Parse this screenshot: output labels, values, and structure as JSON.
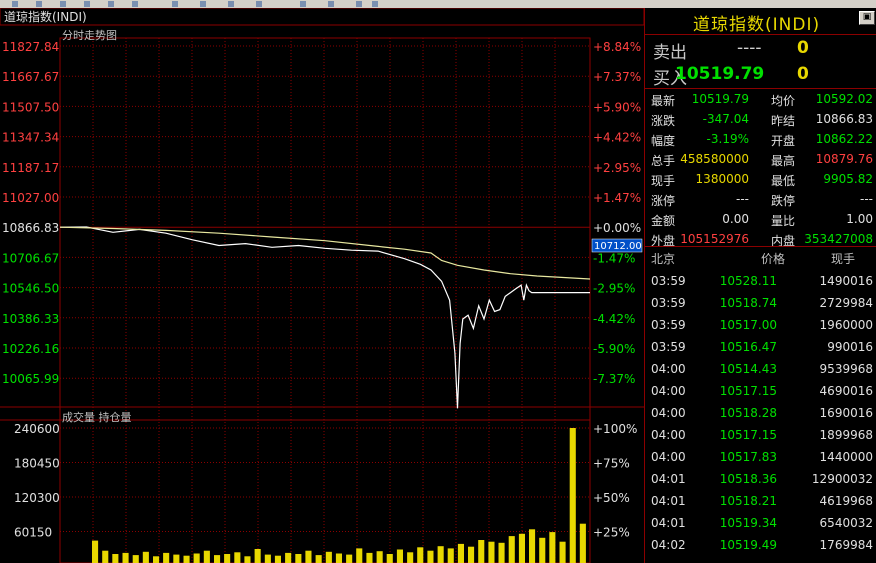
{
  "window": {
    "title": "道琼指数(INDI)"
  },
  "chart_panel": {
    "caption": "道琼指数(INDI)",
    "intraday_label": "分时走势图",
    "volume_label": "成交量 持仓量",
    "current_value_tag": "10712.00",
    "price_axis": [
      "11827.84",
      "11667.67",
      "11507.50",
      "11347.34",
      "11187.17",
      "11027.00",
      "10866.83",
      "10706.67",
      "10546.50",
      "10386.33",
      "10226.16",
      "10065.99"
    ],
    "pct_axis": [
      "+8.84%",
      "+7.37%",
      "+5.90%",
      "+4.42%",
      "+2.95%",
      "+1.47%",
      "+0.00%",
      "-1.47%",
      "-2.95%",
      "-4.42%",
      "-5.90%",
      "-7.37%"
    ],
    "volume_axis": [
      "240600",
      "180450",
      "120300",
      "60150"
    ],
    "volume_pct_axis": [
      "+100%",
      "+75%",
      "+50%",
      "+25%"
    ],
    "colors": {
      "grid": "#8b0000",
      "price_line": "#ffffff",
      "avg_line": "#e8e8a0",
      "volume": "#e8d800",
      "positive": "#ff4040",
      "negative": "#00e000"
    }
  },
  "side_panel": {
    "title": "道琼指数(INDI)",
    "sell": {
      "label": "卖出",
      "price": "----",
      "volume": "0"
    },
    "buy": {
      "label": "买入",
      "price": "10519.79",
      "volume": "0"
    },
    "quote": [
      {
        "l1": "最新",
        "v1": "10519.79",
        "c1": "g",
        "l2": "均价",
        "v2": "10592.02",
        "c2": "g"
      },
      {
        "l1": "涨跌",
        "v1": "-347.04",
        "c1": "g",
        "l2": "昨结",
        "v2": "10866.83",
        "c2": "w"
      },
      {
        "l1": "幅度",
        "v1": "-3.19%",
        "c1": "g",
        "l2": "开盘",
        "v2": "10862.22",
        "c2": "g"
      },
      {
        "l1": "总手",
        "v1": "458580000",
        "c1": "y",
        "l2": "最高",
        "v2": "10879.76",
        "c2": "r"
      },
      {
        "l1": "现手",
        "v1": "1380000",
        "c1": "y",
        "l2": "最低",
        "v2": "9905.82",
        "c2": "g"
      },
      {
        "l1": "涨停",
        "v1": "---",
        "c1": "w",
        "l2": "跌停",
        "v2": "---",
        "c2": "w"
      },
      {
        "l1": "金额",
        "v1": "0.00",
        "c1": "w",
        "l2": "量比",
        "v2": "1.00",
        "c2": "w"
      },
      {
        "l1": "外盘",
        "v1": "105152976",
        "c1": "r",
        "l2": "内盘",
        "v2": "353427008",
        "c2": "g"
      }
    ],
    "ticks_header": {
      "time": "北京",
      "price": "价格",
      "volume": "现手"
    },
    "ticks": [
      {
        "time": "03:59",
        "price": "10528.11",
        "volume": "1490016"
      },
      {
        "time": "03:59",
        "price": "10518.74",
        "volume": "2729984"
      },
      {
        "time": "03:59",
        "price": "10517.00",
        "volume": "1960000"
      },
      {
        "time": "03:59",
        "price": "10516.47",
        "volume": "990016"
      },
      {
        "time": "04:00",
        "price": "10514.43",
        "volume": "9539968"
      },
      {
        "time": "04:00",
        "price": "10517.15",
        "volume": "4690016"
      },
      {
        "time": "04:00",
        "price": "10518.28",
        "volume": "1690016"
      },
      {
        "time": "04:00",
        "price": "10517.15",
        "volume": "1899968"
      },
      {
        "time": "04:00",
        "price": "10517.83",
        "volume": "1440000"
      },
      {
        "time": "04:01",
        "price": "10518.36",
        "volume": "12900032"
      },
      {
        "time": "04:01",
        "price": "10518.21",
        "volume": "4619968"
      },
      {
        "time": "04:01",
        "price": "10519.34",
        "volume": "6540032"
      },
      {
        "time": "04:02",
        "price": "10519.49",
        "volume": "1769984"
      }
    ]
  },
  "chart_data": {
    "type": "line",
    "title": "分时走势图",
    "ylim": [
      9905.82,
      11827.84
    ],
    "reference_close": 10866.83,
    "series": [
      {
        "name": "price",
        "x": [
          0,
          0.05,
          0.1,
          0.15,
          0.2,
          0.25,
          0.3,
          0.35,
          0.4,
          0.45,
          0.5,
          0.55,
          0.6,
          0.65,
          0.68,
          0.7,
          0.72,
          0.735,
          0.745,
          0.75,
          0.755,
          0.76,
          0.77,
          0.78,
          0.79,
          0.8,
          0.81,
          0.82,
          0.83,
          0.84,
          0.85,
          0.86,
          0.87,
          0.875,
          0.88,
          0.885,
          0.89,
          0.9,
          0.93,
          0.96,
          1.0
        ],
        "y": [
          10866.83,
          10868,
          10840,
          10855,
          10835,
          10800,
          10770,
          10780,
          10760,
          10770,
          10755,
          10745,
          10740,
          10700,
          10670,
          10640,
          10580,
          10480,
          10200,
          9905.82,
          10250,
          10380,
          10400,
          10330,
          10450,
          10380,
          10480,
          10420,
          10430,
          10500,
          10520,
          10540,
          10560,
          10480,
          10560,
          10530,
          10520,
          10519.79,
          10519.79,
          10519.79,
          10519.79
        ]
      },
      {
        "name": "average",
        "x": [
          0,
          0.1,
          0.2,
          0.3,
          0.4,
          0.5,
          0.6,
          0.65,
          0.7,
          0.72,
          0.75,
          0.8,
          0.85,
          0.9,
          0.95,
          1.0
        ],
        "y": [
          10866.83,
          10860,
          10850,
          10835,
          10815,
          10795,
          10765,
          10750,
          10730,
          10690,
          10665,
          10640,
          10620,
          10608,
          10600,
          10592.02
        ]
      }
    ],
    "volume": {
      "ylim": [
        0,
        240600
      ],
      "bars": [
        40000,
        22000,
        16000,
        18000,
        14000,
        20000,
        12000,
        18000,
        15000,
        13000,
        17000,
        22000,
        14000,
        16000,
        19000,
        12000,
        25000,
        15000,
        13000,
        18000,
        16000,
        22000,
        14000,
        20000,
        17000,
        15000,
        26000,
        18000,
        21000,
        16000,
        24000,
        19000,
        28000,
        22000,
        30000,
        26000,
        34000,
        29000,
        41000,
        38000,
        36000,
        48000,
        52000,
        60000,
        45000,
        55000,
        38000,
        240600,
        70000
      ]
    }
  }
}
